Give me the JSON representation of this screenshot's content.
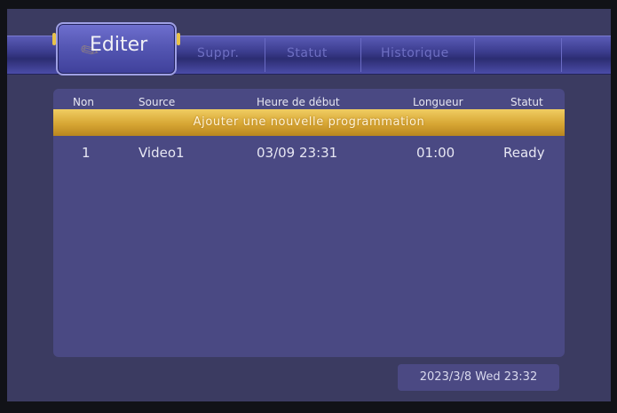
{
  "tabs": {
    "active_label": "Editer",
    "items": [
      "Suppr.",
      "Statut",
      "Historique"
    ]
  },
  "table": {
    "headers": [
      "Non",
      "Source",
      "Heure de début",
      "Longueur",
      "Statut"
    ],
    "add_label": "Ajouter une nouvelle programmation",
    "rows": [
      {
        "num": "1",
        "source": "Video1",
        "start": "03/09 23:31",
        "length": "01:00",
        "status": "Ready"
      }
    ]
  },
  "clock": "2023/3/8 Wed 23:32",
  "colors": {
    "background": "#3b3b61",
    "tabbar": "#3c3d8f",
    "panel": "#4a4983",
    "accent_gold": "#d7a634"
  }
}
